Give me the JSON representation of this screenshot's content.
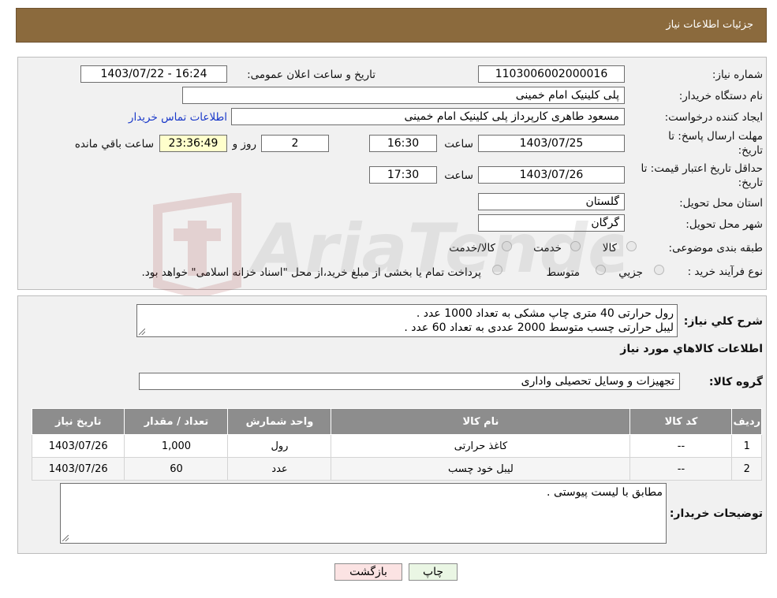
{
  "header": {
    "title": "جزئیات اطلاعات نیاز"
  },
  "form": {
    "need_number_label": "شماره نیاز:",
    "need_number": "1103006002000016",
    "announce_label": "تاریخ و ساعت اعلان عمومی:",
    "announce_value": "1403/07/22 - 16:24",
    "buyer_org_label": "نام دستگاه خریدار:",
    "buyer_org": "پلی کلینیک امام خمینی",
    "requester_label": "ایجاد کننده درخواست:",
    "requester": "مسعود طاهری کارپرداز پلی کلینیک امام خمینی",
    "contact_link": "اطلاعات تماس خریدار",
    "deadline_label_1": "مهلت ارسال پاسخ: تا",
    "deadline_label_2": "تاریخ:",
    "deadline_date": "1403/07/25",
    "time_label": "ساعت",
    "deadline_time": "16:30",
    "days_value": "2",
    "days_label": "روز و",
    "remaining_value": "23:36:49",
    "remaining_label": "ساعت باقي مانده",
    "validity_label_1": "حداقل تاریخ اعتبار قیمت: تا",
    "validity_label_2": "تاریخ:",
    "validity_date": "1403/07/26",
    "validity_time": "17:30",
    "province_label": "استان محل تحویل:",
    "province": "گلستان",
    "city_label": "شهر محل تحویل:",
    "city": "گرگان",
    "category_label": "طبقه بندی موضوعی:",
    "category_options": [
      "کالا",
      "خدمت",
      "کالا/خدمت"
    ],
    "process_label": "نوع فرآیند خرید :",
    "process_options": [
      "جزیي",
      "متوسط"
    ],
    "process_note": "پرداخت تمام یا بخشی از مبلغ خرید،از محل \"اسناد خزانه اسلامی\" خواهد بود."
  },
  "details": {
    "summary_label": "شرح کلي نياز:",
    "summary_lines": [
      "رول حرارتی 40 متری چاپ مشکی به تعداد 1000 عدد .",
      "لیبل حرارتی چسب متوسط 2000 عددی به تعداد 60 عدد ."
    ],
    "items_title": "اطلاعات کالاهاي مورد نياز",
    "group_label": "گروه کالا:",
    "group_value": "تجهیزات و وسایل تحصیلی واداری",
    "columns": [
      "ردیف",
      "کد کالا",
      "نام کالا",
      "واحد شمارش",
      "تعداد / مقدار",
      "تاریخ نیاز"
    ],
    "rows": [
      [
        "1",
        "--",
        "کاغذ حرارتی",
        "رول",
        "1,000",
        "1403/07/26"
      ],
      [
        "2",
        "--",
        "لیبل خود چسب",
        "عدد",
        "60",
        "1403/07/26"
      ]
    ],
    "buyer_notes_label": "توضیحات خریدار:",
    "buyer_notes": "مطابق با لیست پیوستی ."
  },
  "buttons": {
    "print": "چاپ",
    "back": "بازگشت"
  },
  "watermark_text": "AriaTender.neT",
  "colors": {
    "header": "#8b6a3d",
    "table_header": "#8d8d8d",
    "remaining_bg": "#ffffcc",
    "link": "#1a39c9"
  }
}
